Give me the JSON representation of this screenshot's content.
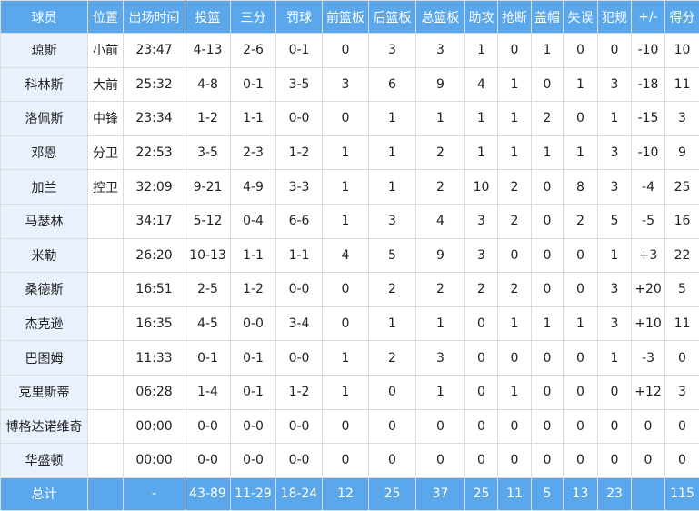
{
  "headers": [
    "球员",
    "位置",
    "出场时间",
    "投篮",
    "三分",
    "罚球",
    "前篮板",
    "后篮板",
    "总篮板",
    "助攻",
    "抢断",
    "盖帽",
    "失误",
    "犯规",
    "+/-",
    "得分"
  ],
  "rows": [
    {
      "player": "琼斯",
      "pos": "小前",
      "min": "23:47",
      "fg": "4-13",
      "tp": "2-6",
      "ft": "0-1",
      "oreb": "0",
      "dreb": "3",
      "reb": "3",
      "ast": "1",
      "stl": "0",
      "blk": "1",
      "tov": "0",
      "pf": "0",
      "pm": "-10",
      "pts": "10"
    },
    {
      "player": "科林斯",
      "pos": "大前",
      "min": "25:32",
      "fg": "4-8",
      "tp": "0-1",
      "ft": "3-5",
      "oreb": "3",
      "dreb": "6",
      "reb": "9",
      "ast": "4",
      "stl": "1",
      "blk": "0",
      "tov": "1",
      "pf": "3",
      "pm": "-18",
      "pts": "11"
    },
    {
      "player": "洛佩斯",
      "pos": "中锋",
      "min": "23:34",
      "fg": "1-2",
      "tp": "1-1",
      "ft": "0-0",
      "oreb": "0",
      "dreb": "1",
      "reb": "1",
      "ast": "1",
      "stl": "1",
      "blk": "2",
      "tov": "0",
      "pf": "1",
      "pm": "-15",
      "pts": "3"
    },
    {
      "player": "邓恩",
      "pos": "分卫",
      "min": "22:53",
      "fg": "3-5",
      "tp": "2-3",
      "ft": "1-2",
      "oreb": "1",
      "dreb": "1",
      "reb": "2",
      "ast": "1",
      "stl": "1",
      "blk": "1",
      "tov": "1",
      "pf": "3",
      "pm": "-10",
      "pts": "9"
    },
    {
      "player": "加兰",
      "pos": "控卫",
      "min": "32:09",
      "fg": "9-21",
      "tp": "4-9",
      "ft": "3-3",
      "oreb": "1",
      "dreb": "1",
      "reb": "2",
      "ast": "10",
      "stl": "2",
      "blk": "0",
      "tov": "8",
      "pf": "3",
      "pm": "-4",
      "pts": "25"
    },
    {
      "player": "马瑟林",
      "pos": "",
      "min": "34:17",
      "fg": "5-12",
      "tp": "0-4",
      "ft": "6-6",
      "oreb": "1",
      "dreb": "3",
      "reb": "4",
      "ast": "3",
      "stl": "2",
      "blk": "0",
      "tov": "2",
      "pf": "5",
      "pm": "-5",
      "pts": "16"
    },
    {
      "player": "米勒",
      "pos": "",
      "min": "26:20",
      "fg": "10-13",
      "tp": "1-1",
      "ft": "1-1",
      "oreb": "4",
      "dreb": "5",
      "reb": "9",
      "ast": "3",
      "stl": "0",
      "blk": "0",
      "tov": "0",
      "pf": "1",
      "pm": "+3",
      "pts": "22"
    },
    {
      "player": "桑德斯",
      "pos": "",
      "min": "16:51",
      "fg": "2-5",
      "tp": "1-2",
      "ft": "0-0",
      "oreb": "0",
      "dreb": "2",
      "reb": "2",
      "ast": "2",
      "stl": "2",
      "blk": "0",
      "tov": "0",
      "pf": "3",
      "pm": "+20",
      "pts": "5"
    },
    {
      "player": "杰克逊",
      "pos": "",
      "min": "16:35",
      "fg": "4-5",
      "tp": "0-0",
      "ft": "3-4",
      "oreb": "0",
      "dreb": "1",
      "reb": "1",
      "ast": "0",
      "stl": "1",
      "blk": "1",
      "tov": "1",
      "pf": "3",
      "pm": "+10",
      "pts": "11"
    },
    {
      "player": "巴图姆",
      "pos": "",
      "min": "11:33",
      "fg": "0-1",
      "tp": "0-1",
      "ft": "0-0",
      "oreb": "1",
      "dreb": "2",
      "reb": "3",
      "ast": "0",
      "stl": "0",
      "blk": "0",
      "tov": "0",
      "pf": "1",
      "pm": "-3",
      "pts": "0"
    },
    {
      "player": "克里斯蒂",
      "pos": "",
      "min": "06:28",
      "fg": "1-4",
      "tp": "0-1",
      "ft": "1-2",
      "oreb": "1",
      "dreb": "0",
      "reb": "1",
      "ast": "0",
      "stl": "1",
      "blk": "0",
      "tov": "0",
      "pf": "0",
      "pm": "+12",
      "pts": "3"
    },
    {
      "player": "博格达诺维奇",
      "pos": "",
      "min": "00:00",
      "fg": "0-0",
      "tp": "0-0",
      "ft": "0-0",
      "oreb": "0",
      "dreb": "0",
      "reb": "0",
      "ast": "0",
      "stl": "0",
      "blk": "0",
      "tov": "0",
      "pf": "0",
      "pm": "0",
      "pts": "0"
    },
    {
      "player": "华盛顿",
      "pos": "",
      "min": "00:00",
      "fg": "0-0",
      "tp": "0-0",
      "ft": "0-0",
      "oreb": "0",
      "dreb": "0",
      "reb": "0",
      "ast": "0",
      "stl": "0",
      "blk": "0",
      "tov": "0",
      "pf": "0",
      "pm": "0",
      "pts": "0"
    }
  ],
  "totals": {
    "label": "总计",
    "pos": "",
    "min": "-",
    "fg": "43-89",
    "tp": "11-29",
    "ft": "18-24",
    "oreb": "12",
    "dreb": "25",
    "reb": "37",
    "ast": "25",
    "stl": "11",
    "blk": "5",
    "tov": "13",
    "pf": "23",
    "pm": "",
    "pts": "115"
  },
  "colors": {
    "header_bg": "#5aa7ec",
    "name_col_bg": "#e9f2fc",
    "grid": "#dcdcdc"
  }
}
